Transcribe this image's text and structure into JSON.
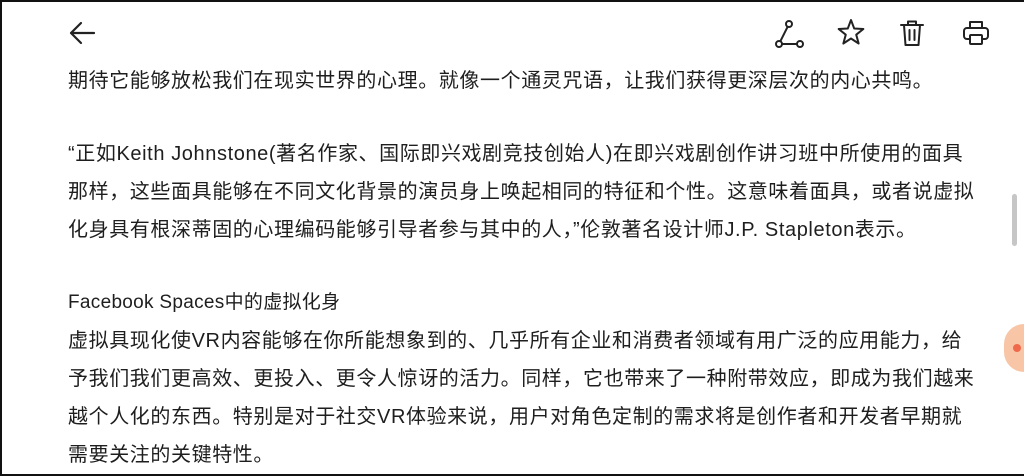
{
  "theme": {
    "text_color": "#1e1e1e",
    "icon_color": "#222222",
    "background": "#ffffff",
    "frame_color": "#111111",
    "scrollbar_color": "#c6c6c6",
    "floating_button_color": "#f8c6a6",
    "floating_dot_color": "#ef6a4c"
  },
  "header": {
    "back_icon": "back-arrow-icon",
    "action_icons": [
      "share-icon",
      "star-icon",
      "trash-icon",
      "print-icon"
    ]
  },
  "article": {
    "paragraph_1": [
      "期待它能够放松我们在现实世界的心理。就像一个通灵咒语，让我们获得更深层次的内心共鸣。"
    ],
    "paragraph_2": [
      "“正如Keith Johnstone(著名作家、国际即兴戏剧竞技创始人)在即兴戏剧创作讲习班中所使用的面具",
      "那样，这些面具能够在不同文化背景的演员身上唤起相同的特征和个性。这意味着面具，或者说虚拟",
      "化身具有根深蒂固的心理编码能够引导者参与其中的人，”伦敦著名设计师J.P. Stapleton表示。"
    ],
    "section": {
      "heading": "Facebook Spaces中的虚拟化身",
      "lines": [
        "虚拟具现化使VR内容能够在你所能想象到的、几乎所有企业和消费者领域有用广泛的应用能力，给",
        "予我们我们更高效、更投入、更令人惊讶的活力。同样，它也带来了一种附带效应，即成为我们越来",
        "越个人化的东西。特别是对于社交VR体验来说，用户对角色定制的需求将是创作者和开发者早期就",
        "需要关注的关键特性。"
      ]
    }
  }
}
